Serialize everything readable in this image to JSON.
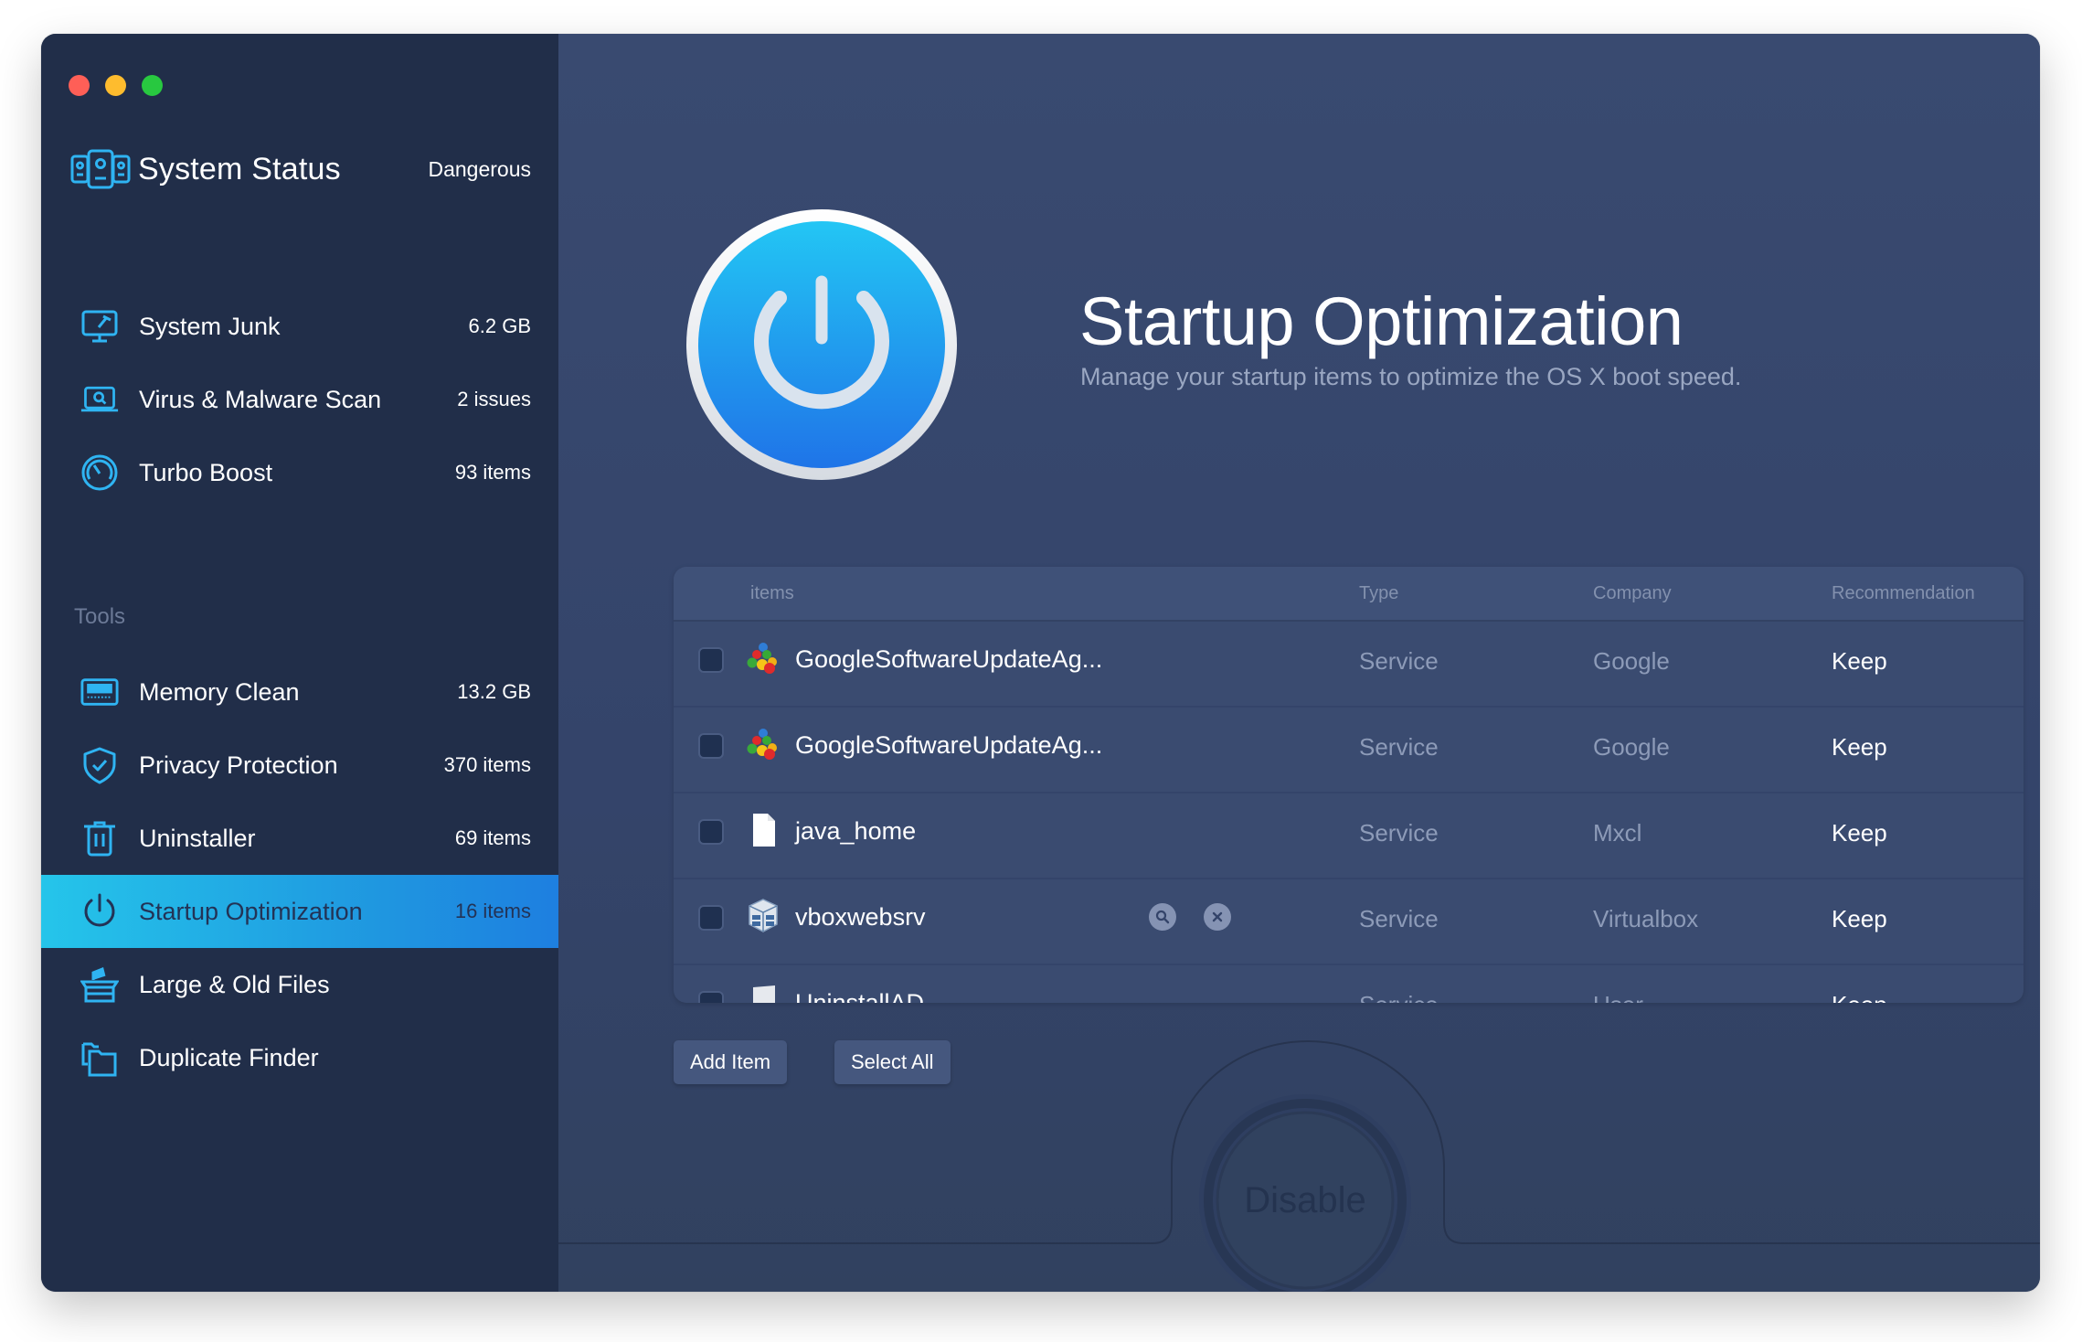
{
  "window": {
    "traffic_lights": [
      "close",
      "minimize",
      "zoom"
    ]
  },
  "sidebar": {
    "status": {
      "icon": "system-status-icon",
      "title": "System Status",
      "value": "Dangerous"
    },
    "items": [
      {
        "icon": "system-junk-icon",
        "label": "System Junk",
        "count": "6.2 GB"
      },
      {
        "icon": "virus-scan-icon",
        "label": "Virus & Malware Scan",
        "count": "2 issues"
      },
      {
        "icon": "turbo-boost-icon",
        "label": "Turbo Boost",
        "count": "93 items"
      }
    ],
    "tools_label": "Tools",
    "tools": [
      {
        "icon": "memory-clean-icon",
        "label": "Memory Clean",
        "count": "13.2 GB"
      },
      {
        "icon": "privacy-shield-icon",
        "label": "Privacy Protection",
        "count": "370 items"
      },
      {
        "icon": "uninstaller-trash-icon",
        "label": "Uninstaller",
        "count": "69 items"
      },
      {
        "icon": "power-icon",
        "label": "Startup Optimization",
        "count": "16 items",
        "active": true
      },
      {
        "icon": "large-files-icon",
        "label": "Large & Old Files",
        "count": ""
      },
      {
        "icon": "duplicate-finder-icon",
        "label": "Duplicate Finder",
        "count": ""
      }
    ]
  },
  "main": {
    "title": "Startup Optimization",
    "subtitle": "Manage your startup items to optimize the OS X boot speed.",
    "table": {
      "columns": [
        "items",
        "Type",
        "Company",
        "Recommendation"
      ],
      "rows": [
        {
          "icon": "google-update-icon",
          "name": "GoogleSoftwareUpdateAg...",
          "type": "Service",
          "company": "Google",
          "recommendation": "Keep",
          "checked": false
        },
        {
          "icon": "google-update-icon",
          "name": "GoogleSoftwareUpdateAg...",
          "type": "Service",
          "company": "Google",
          "recommendation": "Keep",
          "checked": false
        },
        {
          "icon": "document-icon",
          "name": "java_home",
          "type": "Service",
          "company": "Mxcl",
          "recommendation": "Keep",
          "checked": false
        },
        {
          "icon": "virtualbox-icon",
          "name": "vboxwebsrv",
          "type": "Service",
          "company": "Virtualbox",
          "recommendation": "Keep",
          "checked": false,
          "hover_actions": [
            "search-icon",
            "remove-icon"
          ]
        },
        {
          "icon": "document-icon",
          "name": "UninstallAD",
          "type": "Service",
          "company": "User",
          "recommendation": "Keep",
          "checked": false
        }
      ]
    },
    "buttons": {
      "add_item": "Add Item",
      "select_all": "Select All",
      "disable": "Disable"
    }
  },
  "colors": {
    "sidebar_bg": "#212e49",
    "main_bg": "#34446a",
    "accent": "#1fa9e6",
    "icon_blue": "#2fb4f2"
  }
}
